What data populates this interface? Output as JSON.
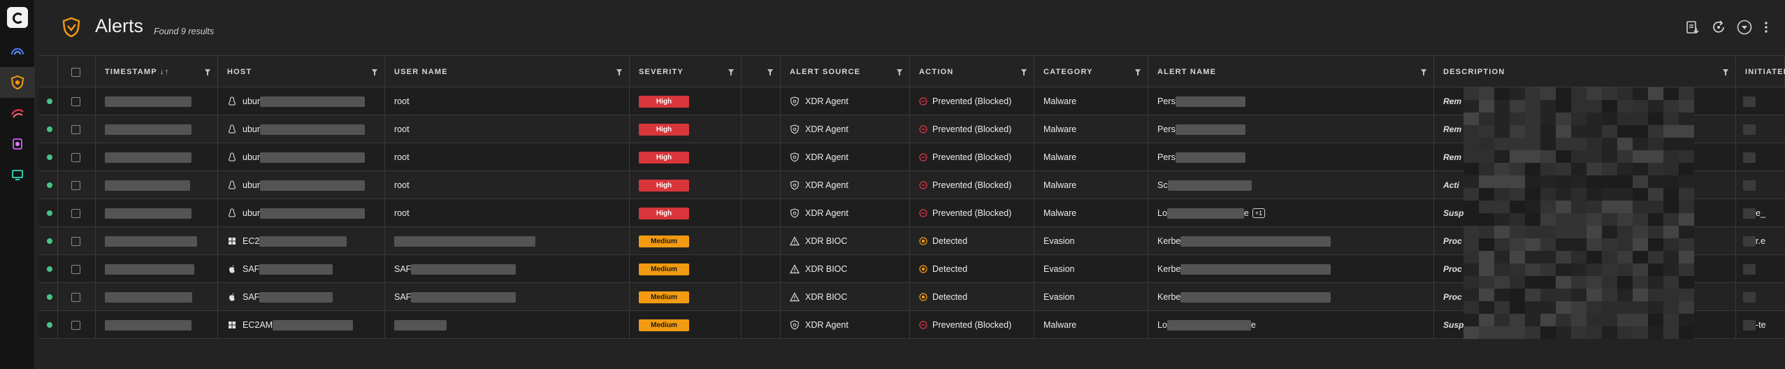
{
  "header": {
    "title": "Alerts",
    "count_text": "Found 9 results"
  },
  "rail": {
    "items": [
      "logo",
      "dashboard-icon",
      "alerts-icon",
      "incidents-icon",
      "investigation-icon",
      "endpoints-icon"
    ]
  },
  "columns": [
    {
      "key": "status",
      "label": ""
    },
    {
      "key": "select",
      "label": ""
    },
    {
      "key": "timestamp",
      "label": "TIMESTAMP ↓↑"
    },
    {
      "key": "host",
      "label": "HOST"
    },
    {
      "key": "user",
      "label": "USER NAME"
    },
    {
      "key": "severity",
      "label": "SEVERITY"
    },
    {
      "key": "blank",
      "label": ""
    },
    {
      "key": "source",
      "label": "ALERT SOURCE"
    },
    {
      "key": "action",
      "label": "ACTION"
    },
    {
      "key": "category",
      "label": "CATEGORY"
    },
    {
      "key": "alert_name",
      "label": "ALERT NAME"
    },
    {
      "key": "description",
      "label": "DESCRIPTION"
    },
    {
      "key": "initiated",
      "label": "INITIATED"
    }
  ],
  "rows": [
    {
      "host_prefix": "ubur",
      "host_os": "linux",
      "user": "root",
      "severity": "High",
      "source": "XDR Agent",
      "action": "Prevented (Blocked)",
      "category": "Malware",
      "alert_prefix": "Pers",
      "desc_prefix": "Rem",
      "initiated": ""
    },
    {
      "host_prefix": "ubur",
      "host_os": "linux",
      "user": "root",
      "severity": "High",
      "source": "XDR Agent",
      "action": "Prevented (Blocked)",
      "category": "Malware",
      "alert_prefix": "Pers",
      "desc_prefix": "Rem",
      "initiated": ""
    },
    {
      "host_prefix": "ubur",
      "host_os": "linux",
      "user": "root",
      "severity": "High",
      "source": "XDR Agent",
      "action": "Prevented (Blocked)",
      "category": "Malware",
      "alert_prefix": "Pers",
      "desc_prefix": "Rem",
      "initiated": ""
    },
    {
      "host_prefix": "ubur",
      "host_os": "linux",
      "user": "root",
      "severity": "High",
      "source": "XDR Agent",
      "action": "Prevented (Blocked)",
      "category": "Malware",
      "alert_prefix": "Sc",
      "desc_prefix": "Acti",
      "initiated": ""
    },
    {
      "host_prefix": "ubur",
      "host_os": "linux",
      "user": "root",
      "severity": "High",
      "source": "XDR Agent",
      "action": "Prevented (Blocked)",
      "category": "Malware",
      "alert_prefix": "Lo",
      "alert_suffix": "e",
      "alert_badge": "+1",
      "desc_prefix": "Susp",
      "initiated": "e_"
    },
    {
      "host_prefix": "EC2",
      "host_os": "windows",
      "user": "",
      "severity": "Medium",
      "source": "XDR BIOC",
      "action": "Detected",
      "category": "Evasion",
      "alert_prefix": "Kerbe",
      "desc_prefix": "Proc",
      "initiated": "r.e"
    },
    {
      "host_prefix": "SAF",
      "host_os": "mac",
      "user": "SAF",
      "severity": "Medium",
      "source": "XDR BIOC",
      "action": "Detected",
      "category": "Evasion",
      "alert_prefix": "Kerbe",
      "desc_prefix": "Proc",
      "initiated": ""
    },
    {
      "host_prefix": "SAF",
      "host_os": "mac",
      "user": "SAF",
      "severity": "Medium",
      "source": "XDR BIOC",
      "action": "Detected",
      "category": "Evasion",
      "alert_prefix": "Kerbe",
      "desc_prefix": "Proc",
      "initiated": ""
    },
    {
      "host_prefix": "EC2AM",
      "host_os": "windows",
      "user": "",
      "severity": "Medium",
      "source": "XDR Agent",
      "action": "Prevented (Blocked)",
      "category": "Malware",
      "alert_prefix": "Lo",
      "alert_suffix": "e",
      "desc_prefix": "Susp",
      "initiated": "-te"
    }
  ],
  "colors": {
    "high": "#d8363b",
    "medium": "#f29b12",
    "status_dot": "#47c389",
    "accent": "#f29b12"
  }
}
